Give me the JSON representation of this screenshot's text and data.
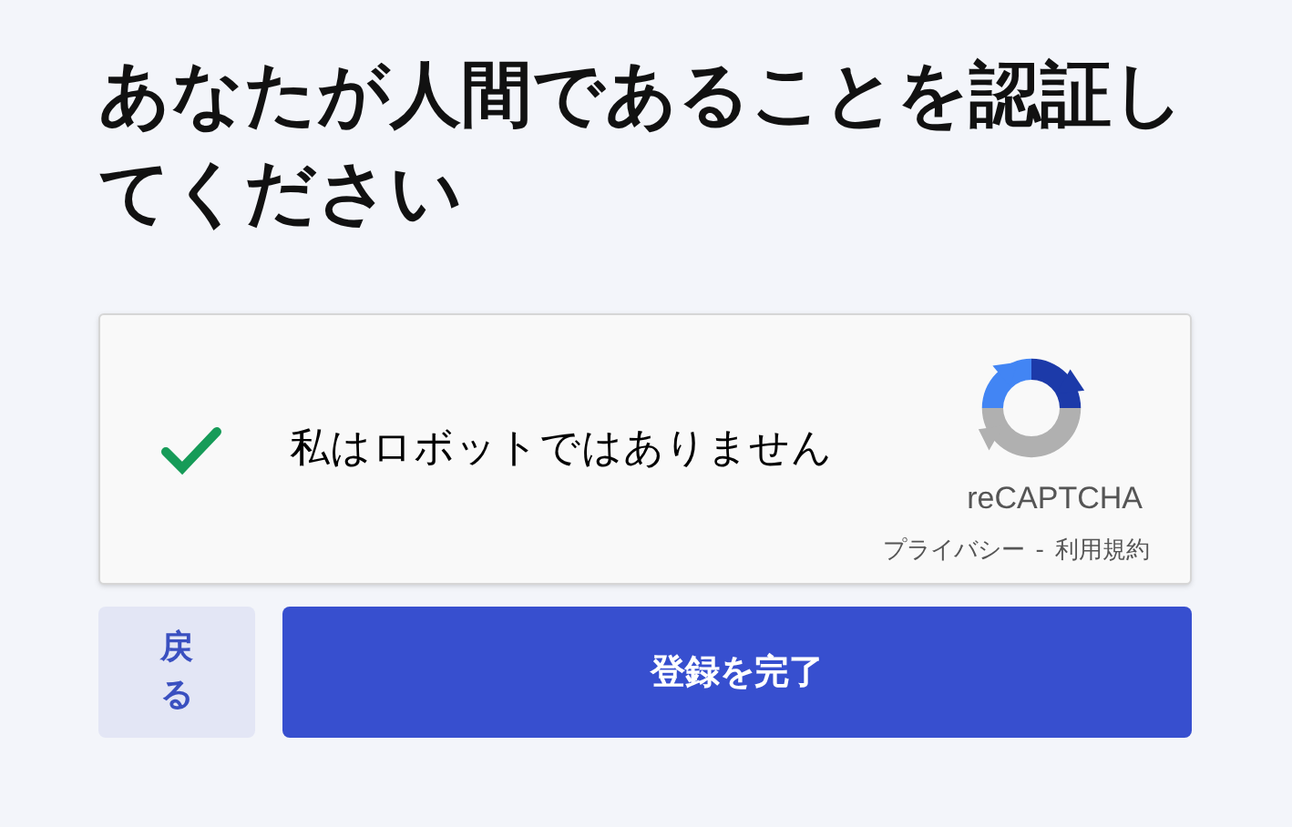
{
  "heading": "あなたが人間であることを認証してください",
  "captcha": {
    "checked": true,
    "label": "私はロボットではありません",
    "brand": "reCAPTCHA",
    "privacy_link": "プライバシー",
    "separator": "-",
    "terms_link": "利用規約"
  },
  "buttons": [
    {
      "kind": "secondary",
      "label": "戻る"
    },
    {
      "kind": "primary",
      "label": "登録を完了"
    }
  ]
}
